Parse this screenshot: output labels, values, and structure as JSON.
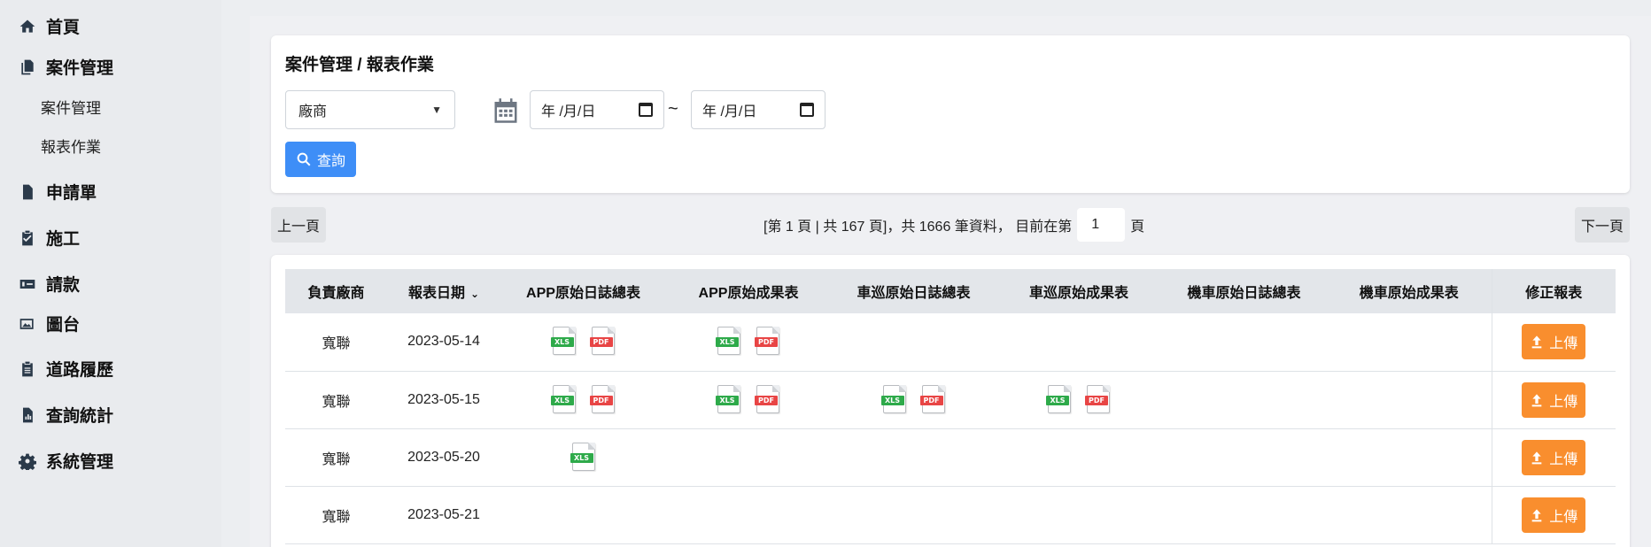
{
  "sidebar": {
    "items": [
      {
        "label": "首頁",
        "icon": "home-icon"
      },
      {
        "label": "案件管理",
        "icon": "files-icon"
      },
      {
        "label": "申請單",
        "icon": "document-icon"
      },
      {
        "label": "施工",
        "icon": "clipboard-check-icon"
      },
      {
        "label": "請款",
        "icon": "money-card-icon"
      },
      {
        "label": "圖台",
        "icon": "map-image-icon"
      },
      {
        "label": "道路履歷",
        "icon": "clipboard-list-icon"
      },
      {
        "label": "查詢統計",
        "icon": "chart-file-icon"
      },
      {
        "label": "系統管理",
        "icon": "gear-icon"
      }
    ],
    "subitems": [
      {
        "label": "案件管理"
      },
      {
        "label": "報表作業"
      }
    ]
  },
  "filter": {
    "title": "案件管理 / 報表作業",
    "vendor_select": "廠商",
    "date_from": "年 /月/日",
    "date_to": "年 /月/日",
    "separator": "~",
    "query_label": "查詢"
  },
  "pagination": {
    "prev_label": "上一頁",
    "next_label": "下一頁",
    "info": "[第 1 頁 | 共 167 頁]，共 1666 筆資料， 目前在第",
    "current_page": "1",
    "page_suffix": "頁"
  },
  "table": {
    "headers": [
      "負責廠商",
      "報表日期",
      "APP原始日誌總表",
      "APP原始成果表",
      "車巡原始日誌總表",
      "車巡原始成果表",
      "機車原始日誌總表",
      "機車原始成果表",
      "修正報表"
    ],
    "upload_label": "上傳",
    "rows": [
      {
        "vendor": "寬聯",
        "date": "2023-05-14",
        "files": [
          [
            "xls",
            "pdf"
          ],
          [
            "xls",
            "pdf"
          ],
          [],
          [],
          [],
          []
        ]
      },
      {
        "vendor": "寬聯",
        "date": "2023-05-15",
        "files": [
          [
            "xls",
            "pdf"
          ],
          [
            "xls",
            "pdf"
          ],
          [
            "xls",
            "pdf"
          ],
          [
            "xls",
            "pdf"
          ],
          [],
          []
        ]
      },
      {
        "vendor": "寬聯",
        "date": "2023-05-20",
        "files": [
          [
            "xls"
          ],
          [],
          [],
          [],
          [],
          []
        ]
      },
      {
        "vendor": "寬聯",
        "date": "2023-05-21",
        "files": [
          [],
          [],
          [],
          [],
          [],
          []
        ]
      }
    ]
  },
  "colors": {
    "primary": "#3e8ef7",
    "upload": "#f98e2e",
    "xls": "#2eaa4a",
    "pdf": "#e84545"
  }
}
